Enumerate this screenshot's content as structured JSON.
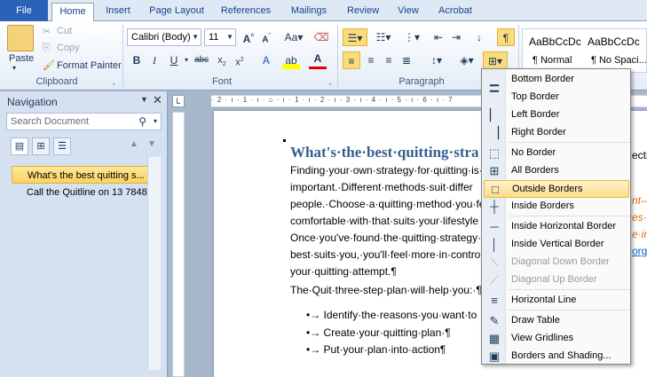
{
  "tabs": [
    {
      "label": "File"
    },
    {
      "label": "Home"
    },
    {
      "label": "Insert"
    },
    {
      "label": "Page Layout"
    },
    {
      "label": "References"
    },
    {
      "label": "Mailings"
    },
    {
      "label": "Review"
    },
    {
      "label": "View"
    },
    {
      "label": "Acrobat"
    }
  ],
  "ribbon": {
    "clipboard": {
      "paste": "Paste",
      "cut": "Cut",
      "copy": "Copy",
      "format_painter": "Format Painter",
      "label": "Clipboard"
    },
    "font": {
      "name": "Calibri (Body)",
      "size": "11",
      "label": "Font"
    },
    "paragraph": {
      "label": "Paragraph"
    },
    "styles": [
      {
        "preview": "AaBbCcDc",
        "name": "¶ Normal"
      },
      {
        "preview": "AaBbCcDc",
        "name": "¶ No Spaci..."
      }
    ]
  },
  "navigation": {
    "title": "Navigation",
    "search_placeholder": "Search Document",
    "headings": [
      "What's the best quitting s...",
      "Call the Quitline on 13 7848"
    ]
  },
  "ruler_text": "· 2 · ı · 1 · ı · ⌂ · ı · 1 · ı · 2 · ı · 3 · ı · 4 · ı · 5 · ı · 6 · ı · 7",
  "document": {
    "heading": "What's·the·best·quitting·stra",
    "lines": [
      "Finding·your·own·strategy·for·quitting·is·",
      "important.·Different·methods·suit·differ",
      "people.·Choose·a·quitting·method·you·fe",
      "comfortable·with·that·suits·your·lifestyle",
      "Once·you've·found·the·quitting·strategy·",
      "best·suits·you,·you'll·feel·more·in·control",
      "your·quitting·attempt.¶",
      "The·Quit·three-step·plan·will·help·you:·¶"
    ],
    "bullets": [
      "•→ Identify·the·reasons·you·want·to",
      "•→ Create·your·quitting·plan·¶",
      "•→ Put·your·plan·into·action¶"
    ],
    "right_fragments": [
      "ectio",
      "nt—",
      "es·b",
      "e·in",
      "org"
    ]
  },
  "borders_menu": {
    "items": [
      {
        "label": "Bottom Border",
        "icon": "bottom-border-icon",
        "glyph": "▁",
        "disabled": false
      },
      {
        "label": "Top Border",
        "icon": "top-border-icon",
        "glyph": "▔",
        "disabled": false
      },
      {
        "label": "Left Border",
        "icon": "left-border-icon",
        "glyph": "▏",
        "disabled": false
      },
      {
        "label": "Right Border",
        "icon": "right-border-icon",
        "glyph": "▕",
        "disabled": false
      },
      {
        "label": "No Border",
        "icon": "no-border-icon",
        "glyph": "⬚",
        "disabled": false
      },
      {
        "label": "All Borders",
        "icon": "all-borders-icon",
        "glyph": "⊞",
        "disabled": false
      },
      {
        "label": "Outside Borders",
        "icon": "outside-borders-icon",
        "glyph": "□",
        "disabled": false
      },
      {
        "label": "Inside Borders",
        "icon": "inside-borders-icon",
        "glyph": "┼",
        "disabled": false
      },
      {
        "label": "Inside Horizontal Border",
        "icon": "inside-horizontal-border-icon",
        "glyph": "─",
        "disabled": false
      },
      {
        "label": "Inside Vertical Border",
        "icon": "inside-vertical-border-icon",
        "glyph": "│",
        "disabled": false
      },
      {
        "label": "Diagonal Down Border",
        "icon": "diagonal-down-border-icon",
        "glyph": "⟍",
        "disabled": true
      },
      {
        "label": "Diagonal Up Border",
        "icon": "diagonal-up-border-icon",
        "glyph": "⟋",
        "disabled": true
      },
      {
        "label": "Horizontal Line",
        "icon": "horizontal-line-icon",
        "glyph": "≡",
        "disabled": false
      },
      {
        "label": "Draw Table",
        "icon": "draw-table-icon",
        "glyph": "✎",
        "disabled": false
      },
      {
        "label": "View Gridlines",
        "icon": "view-gridlines-icon",
        "glyph": "▦",
        "disabled": false
      },
      {
        "label": "Borders and Shading...",
        "icon": "borders-and-shading-icon",
        "glyph": "▣",
        "disabled": false
      }
    ],
    "highlighted": "Outside Borders"
  }
}
